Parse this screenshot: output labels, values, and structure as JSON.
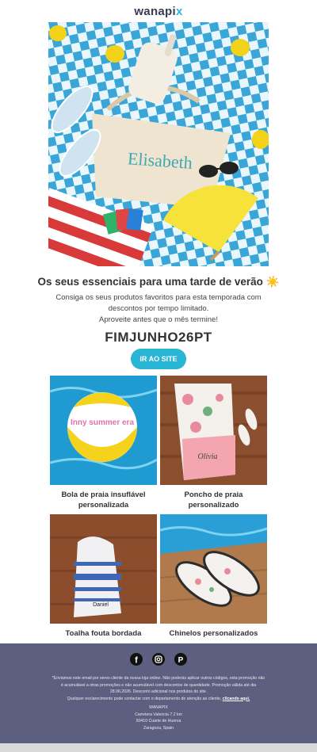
{
  "brand": {
    "logo_text": "wanapix"
  },
  "hero": {
    "bag_name": "Elisabeth"
  },
  "promo": {
    "headline": "Os seus essenciais para uma tarde de verão ☀️",
    "subtext_line1": "Consiga os seus produtos favoritos para esta temporada com",
    "subtext_line2": "descontos por tempo limitado.",
    "subtext_line3": "Aproveite antes que o mês termine!",
    "code": "FIMJUNHO26PT",
    "cta_label": "IR AO SITE"
  },
  "products": [
    {
      "label": "Bola de praia insuflável personalizada",
      "image_text": "Inny summer era"
    },
    {
      "label": "Poncho de praia personalizado",
      "image_text": "Olivia"
    },
    {
      "label": "Toalha fouta bordada",
      "image_text": "Daniel"
    },
    {
      "label": "Chinelos personalizados"
    }
  ],
  "footer": {
    "social_icons": [
      "facebook-icon",
      "instagram-icon",
      "pinterest-icon"
    ],
    "disclaimer_line1": "*Enviamos este email por seres cliente da nossa loja online. Não poderás aplicar outros códigos, esta promoção não",
    "disclaimer_line2": "é acumulável a otras promoções e não acumulável com descontos de quantidade. Promoção válida até dia",
    "disclaimer_line3": "28.06.2026. Desconto adicional nos produtos do site.",
    "contact_text": "Qualquer esclarecimento pode contactar com o departamento de atenção ao cliente,",
    "contact_link": "clicando aqui.",
    "company": "WANAPIX",
    "address_line1": "Carretera Valencia 7.2 km",
    "address_line2": "50410 Cuarte de Huerva",
    "address_line3": "Zaragoza, Spain"
  },
  "colors": {
    "accent": "#29b6d6",
    "footer_bg": "#5c5f7f",
    "text": "#333333"
  }
}
